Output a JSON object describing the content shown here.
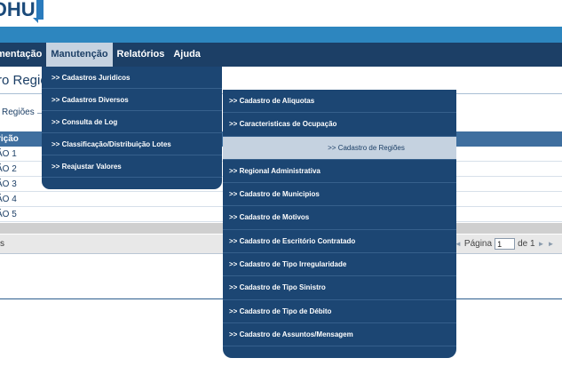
{
  "logo": {
    "text": "DHU"
  },
  "navbar": {
    "items": [
      {
        "label": "mentação"
      },
      {
        "label": "Manutenção",
        "active": true
      },
      {
        "label": "Relatórios"
      },
      {
        "label": "Ajuda"
      }
    ]
  },
  "page": {
    "title": "ro Regiõ",
    "fieldset_legend": "Regiões"
  },
  "grid": {
    "header": "rição",
    "rows": [
      "ÃO 1",
      "ÃO 2",
      "ÃO 3",
      "ÃO 4",
      "ÃO 5"
    ]
  },
  "pager": {
    "left_text": "s",
    "page_label": "Página",
    "page_value": "1",
    "of_label": "de 1"
  },
  "menu_manutencao": {
    "items": [
      ">> Cadastros Juridicos",
      ">> Cadastros Diversos",
      ">> Consulta de Log",
      ">> Classificação/Distribuição Lotes",
      ">> Reajustar Valores"
    ]
  },
  "menu_cadastros_diversos": {
    "items": [
      ">> Cadastro de Aliquotas",
      ">> Caracteristicas de Ocupação",
      ">> Cadastro de Regiões",
      ">> Regional Administrativa",
      ">> Cadastro de Municipios",
      ">> Cadastro de Motivos",
      ">> Cadastro de Escritório Contratado",
      ">> Cadastro de Tipo Irregularidade",
      ">> Cadastro de Tipo Sinistro",
      ">> Cadastro de Tipo de Débito",
      ">> Cadastro de Assuntos/Mensagem"
    ],
    "selected_index": 2
  },
  "colors": {
    "nav_bg": "#1c3f66",
    "band": "#2d86bf",
    "menu_bg": "#1c4673",
    "selected_bg": "#c5d2e0"
  }
}
